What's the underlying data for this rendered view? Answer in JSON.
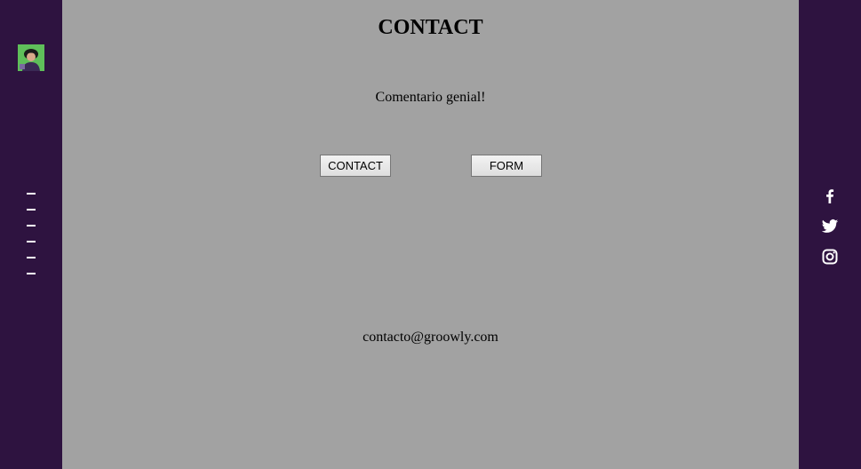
{
  "page": {
    "title": "CONTACT",
    "comment": "Comentario genial!",
    "email": "contacto@groowly.com"
  },
  "buttons": {
    "contact_label": "CONTACT",
    "form_label": "FORM"
  },
  "left_nav": {
    "avatar_icon": "user-avatar",
    "items": [
      "menu-item",
      "menu-item",
      "menu-item",
      "menu-item",
      "menu-item",
      "menu-item"
    ]
  },
  "social": [
    {
      "name": "facebook-icon"
    },
    {
      "name": "twitter-icon"
    },
    {
      "name": "instagram-icon"
    }
  ],
  "colors": {
    "sidebar": "#2e1340",
    "main_background": "#a2a2a2",
    "icon": "#ffffff"
  }
}
